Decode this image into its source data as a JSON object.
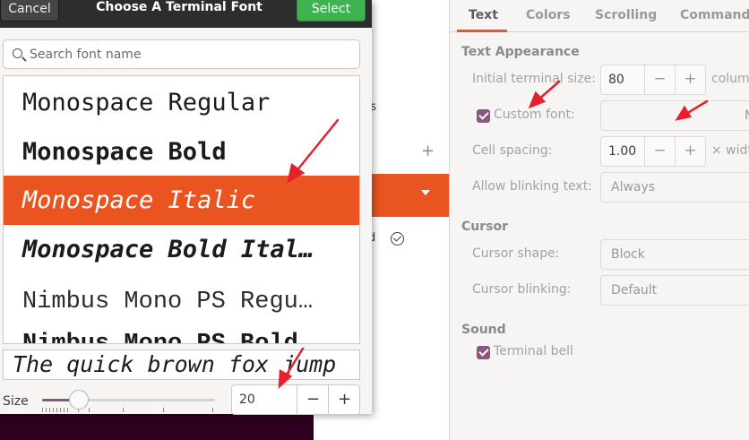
{
  "dialog": {
    "title": "Choose A Terminal Font",
    "cancel_label": "Cancel",
    "select_label": "Select",
    "search_placeholder": "Search font name",
    "fonts": [
      "Monospace Regular",
      "Monospace Bold",
      "Monospace Italic",
      "Monospace Bold Ital…",
      "Nimbus Mono PS Regu…",
      "Nimbus Mono PS Bold"
    ],
    "selected_font_index": 2,
    "preview_text": "The quick brown fox jump",
    "size_label": "Size",
    "size_value": "20",
    "size_minus": "−",
    "size_plus": "+"
  },
  "middle": {
    "frag_rs": "rs",
    "frag_d": "d",
    "plus": "+"
  },
  "prefs": {
    "tabs": [
      "Text",
      "Colors",
      "Scrolling",
      "Command"
    ],
    "active_tab": 0,
    "text_appearance": {
      "heading": "Text Appearance",
      "initial_size_label": "Initial terminal size:",
      "initial_size_value": "80",
      "initial_size_suffix": "colum",
      "custom_font_label": "Custom font:",
      "custom_font_checked": true,
      "custom_font_value": "M",
      "cell_spacing_label": "Cell spacing:",
      "cell_spacing_value": "1.00",
      "cell_spacing_suffix": "× widt",
      "blinking_label": "Allow blinking text:",
      "blinking_value": "Always"
    },
    "cursor": {
      "heading": "Cursor",
      "shape_label": "Cursor shape:",
      "shape_value": "Block",
      "blinking_label": "Cursor blinking:",
      "blinking_value": "Default"
    },
    "sound": {
      "heading": "Sound",
      "bell_label": "Terminal bell",
      "bell_checked": true
    },
    "stepper_minus": "−",
    "stepper_plus": "+"
  },
  "colors": {
    "accent": "#e95420",
    "select_green": "#3eb34f",
    "checkbox": "#875a7b",
    "titlebar": "#2d2d2d",
    "annotation_arrow": "#e8202a"
  }
}
